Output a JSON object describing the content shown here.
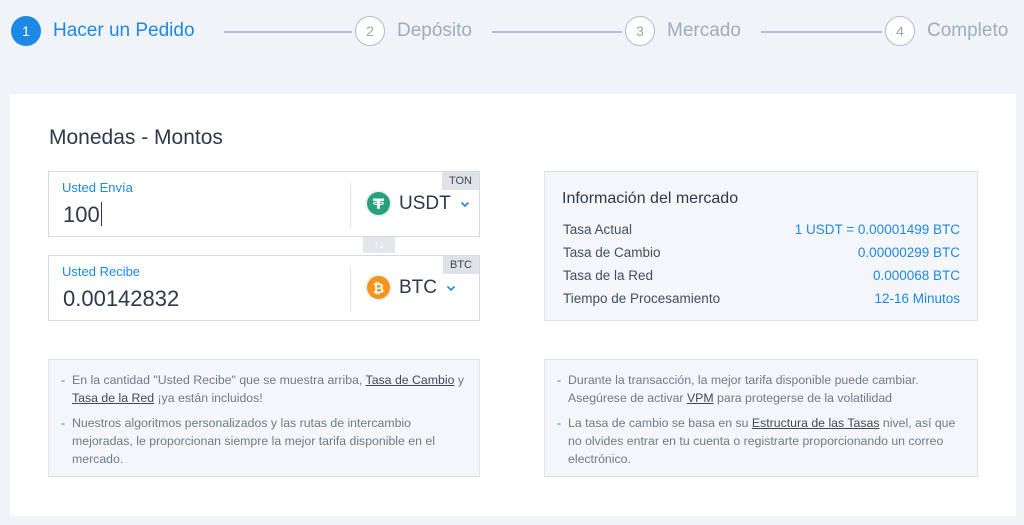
{
  "stepper": {
    "steps": [
      {
        "num": "1",
        "label": "Hacer un Pedido"
      },
      {
        "num": "2",
        "label": "Depósito"
      },
      {
        "num": "3",
        "label": "Mercado"
      },
      {
        "num": "4",
        "label": "Completo"
      }
    ]
  },
  "exchange": {
    "title": "Monedas - Montos",
    "send": {
      "label": "Usted Envía",
      "value": "100",
      "coin": "USDT",
      "network": "TON",
      "icon": "tether-icon"
    },
    "receive": {
      "label": "Usted Recibe",
      "value": "0.00142832",
      "coin": "BTC",
      "network": "BTC",
      "icon": "bitcoin-icon"
    },
    "swap_icon": "↑↓"
  },
  "market": {
    "title": "Información del mercado",
    "rows": [
      {
        "key": "Tasa Actual",
        "value": "1 USDT = 0.00001499 BTC"
      },
      {
        "key": "Tasa de Cambio",
        "value": "0.00000299 BTC"
      },
      {
        "key": "Tasa de la Red",
        "value": "0.000068 BTC"
      },
      {
        "key": "Tiempo de Procesamiento",
        "value": "12-16 Minutos"
      }
    ]
  },
  "notes_left": {
    "n1": {
      "pre": "En la cantidad \"Usted Recibe\" que se muestra arriba, ",
      "link1": "Tasa de Cambio",
      "mid": " y ",
      "link2": "Tasa de la Red",
      "post": " ¡ya están incluidos!"
    },
    "n2": "Nuestros algoritmos personalizados y las rutas de intercambio mejoradas, le proporcionan siempre la mejor tarifa disponible en el mercado."
  },
  "notes_right": {
    "n1": {
      "pre": "Durante la transacción, la mejor tarifa disponible puede cambiar. Asegúrese de activar ",
      "link": "VPM",
      "post": " para protegerse de la volatilidad"
    },
    "n2": {
      "pre": "La tasa de cambio se basa en su ",
      "link": "Estructura de las Tasas",
      "post": " nivel, así que no olvides entrar en tu cuenta o registrarte proporcionando un correo electrónico."
    }
  },
  "colors": {
    "accent": "#1e88e5",
    "tether": "#26a17b",
    "bitcoin": "#f7931a"
  }
}
